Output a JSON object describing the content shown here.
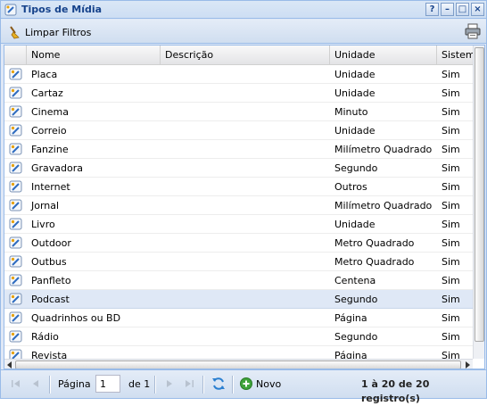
{
  "window": {
    "title": "Tipos de Mídia",
    "tools": [
      "?",
      "–",
      "□",
      "×"
    ]
  },
  "toolbar": {
    "clear_label": "Limpar Filtros",
    "clear_icon": "broom-icon",
    "print_icon": "printer-icon"
  },
  "grid": {
    "columns": [
      "Nome",
      "Descrição",
      "Unidade",
      "Sistema"
    ],
    "rows": [
      {
        "nome": "Placa",
        "descricao": "",
        "unidade": "Unidade",
        "sistema": "Sim"
      },
      {
        "nome": "Cartaz",
        "descricao": "",
        "unidade": "Unidade",
        "sistema": "Sim"
      },
      {
        "nome": "Cinema",
        "descricao": "",
        "unidade": "Minuto",
        "sistema": "Sim"
      },
      {
        "nome": "Correio",
        "descricao": "",
        "unidade": "Unidade",
        "sistema": "Sim"
      },
      {
        "nome": "Fanzine",
        "descricao": "",
        "unidade": "Milímetro Quadrado",
        "sistema": "Sim"
      },
      {
        "nome": "Gravadora",
        "descricao": "",
        "unidade": "Segundo",
        "sistema": "Sim"
      },
      {
        "nome": "Internet",
        "descricao": "",
        "unidade": "Outros",
        "sistema": "Sim"
      },
      {
        "nome": "Jornal",
        "descricao": "",
        "unidade": "Milímetro Quadrado",
        "sistema": "Sim"
      },
      {
        "nome": "Livro",
        "descricao": "",
        "unidade": "Unidade",
        "sistema": "Sim"
      },
      {
        "nome": "Outdoor",
        "descricao": "",
        "unidade": "Metro Quadrado",
        "sistema": "Sim"
      },
      {
        "nome": "Outbus",
        "descricao": "",
        "unidade": "Metro Quadrado",
        "sistema": "Sim"
      },
      {
        "nome": "Panfleto",
        "descricao": "",
        "unidade": "Centena",
        "sistema": "Sim"
      },
      {
        "nome": "Podcast",
        "descricao": "",
        "unidade": "Segundo",
        "sistema": "Sim",
        "selected": true
      },
      {
        "nome": "Quadrinhos ou BD",
        "descricao": "",
        "unidade": "Página",
        "sistema": "Sim"
      },
      {
        "nome": "Rádio",
        "descricao": "",
        "unidade": "Segundo",
        "sistema": "Sim"
      },
      {
        "nome": "Revista",
        "descricao": "",
        "unidade": "Página",
        "sistema": "Sim"
      }
    ]
  },
  "paging": {
    "page_label": "Página",
    "page_value": "1",
    "of_label": "de 1",
    "new_label": "Novo",
    "summary": "1 à 20 de 20 registro(s)"
  }
}
